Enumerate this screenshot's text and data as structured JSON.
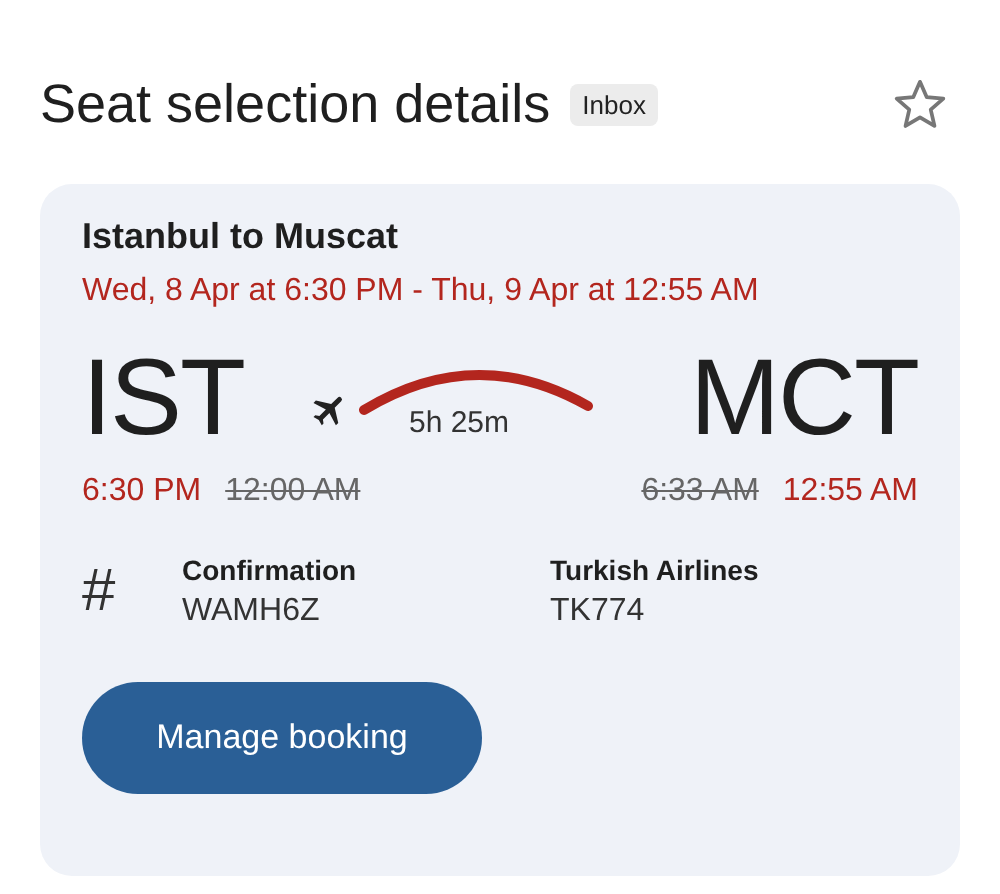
{
  "header": {
    "title": "Seat selection details",
    "label": "Inbox",
    "starred": false
  },
  "flight": {
    "route": "Istanbul to Muscat",
    "dates": "Wed, 8 Apr at 6:30 PM - Thu, 9 Apr at 12:55 AM",
    "origin": "IST",
    "destination": "MCT",
    "duration": "5h 25m",
    "departure_times": [
      {
        "text": "6:30 PM",
        "struck": false
      },
      {
        "text": "12:00 AM",
        "struck": true
      }
    ],
    "arrival_times": [
      {
        "text": "6:33 AM",
        "struck": true
      },
      {
        "text": "12:55 AM",
        "struck": false
      }
    ],
    "details_icon": "#",
    "details": [
      {
        "label": "Confirmation",
        "value": "WAMH6Z"
      },
      {
        "label": "Turkish Airlines",
        "value": "TK774"
      }
    ],
    "button": "Manage booking"
  }
}
